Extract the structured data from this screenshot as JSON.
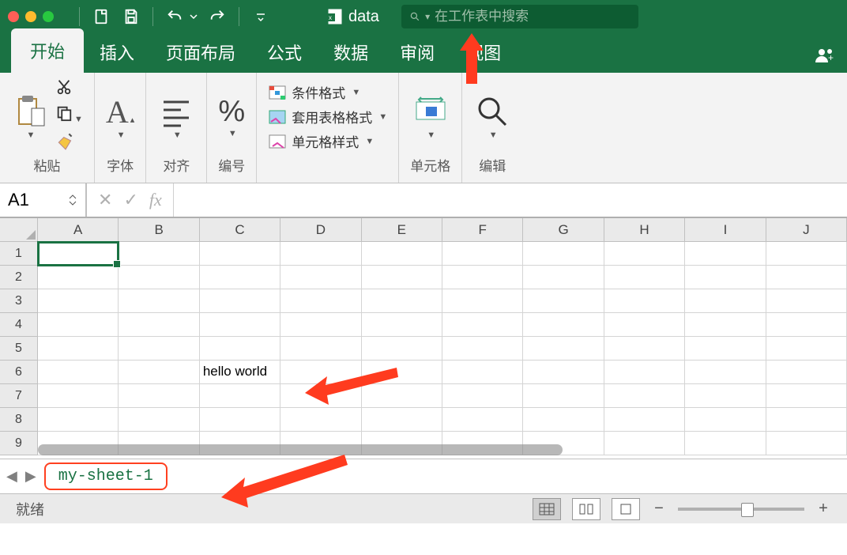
{
  "doc_title": "data",
  "search": {
    "placeholder": "在工作表中搜索"
  },
  "tabs": {
    "home": "开始",
    "insert": "插入",
    "layout": "页面布局",
    "formulas": "公式",
    "data": "数据",
    "review": "审阅",
    "view": "视图"
  },
  "ribbon": {
    "paste": "粘贴",
    "font": "字体",
    "align": "对齐",
    "number": "编号",
    "cond_format": "条件格式",
    "table_format": "套用表格格式",
    "cell_styles": "单元格样式",
    "cells": "单元格",
    "edit": "编辑"
  },
  "namebox": "A1",
  "formula": "",
  "columns": [
    "A",
    "B",
    "C",
    "D",
    "E",
    "F",
    "G",
    "H",
    "I",
    "J"
  ],
  "rows": [
    "1",
    "2",
    "3",
    "4",
    "5",
    "6",
    "7",
    "8",
    "9"
  ],
  "cell_c6": "hello world",
  "sheet_tab": "my-sheet-1",
  "status": "就绪"
}
